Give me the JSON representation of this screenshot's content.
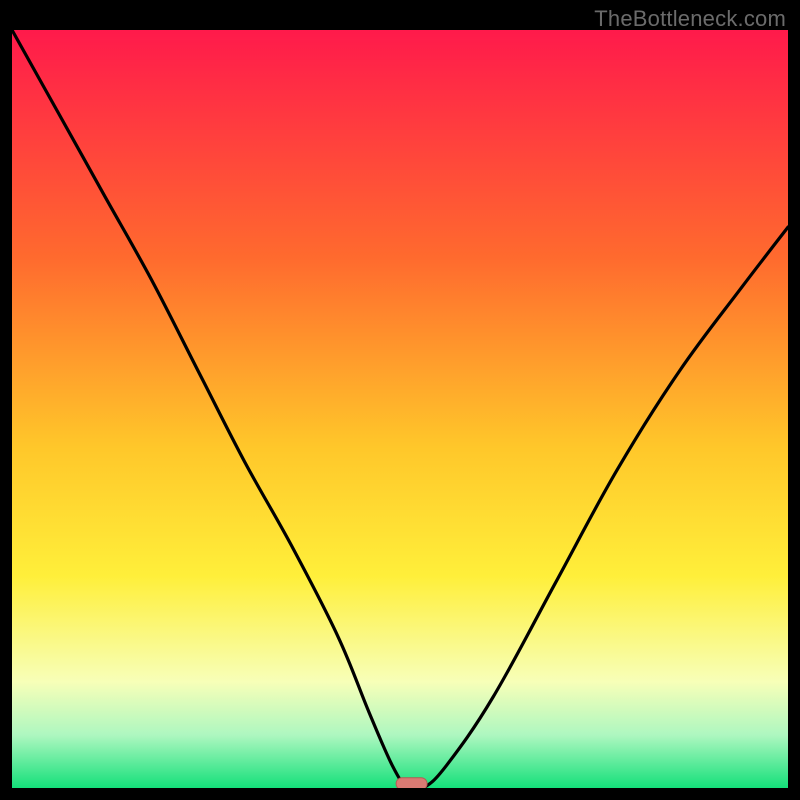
{
  "watermark": "TheBottleneck.com",
  "colors": {
    "black": "#000000",
    "grad_top": "#ff1a4b",
    "grad_mid1": "#ff6a2e",
    "grad_mid2": "#ffc72a",
    "grad_mid3": "#ffef3a",
    "grad_low1": "#f7ffb8",
    "grad_low2": "#aef7c0",
    "grad_bottom": "#14e07a",
    "curve": "#000000",
    "marker_fill": "#d97a73",
    "marker_stroke": "#b55a52"
  },
  "chart_data": {
    "type": "line",
    "title": "",
    "xlabel": "",
    "ylabel": "",
    "xlim": [
      0,
      100
    ],
    "ylim": [
      0,
      100
    ],
    "series": [
      {
        "name": "bottleneck-curve",
        "x": [
          0,
          6,
          12,
          18,
          24,
          30,
          36,
          42,
          46,
          49,
          51,
          53,
          56,
          62,
          70,
          78,
          86,
          94,
          100
        ],
        "y": [
          100,
          89,
          78,
          67,
          55,
          43,
          32,
          20,
          10,
          3,
          0,
          0,
          3,
          12,
          27,
          42,
          55,
          66,
          74
        ]
      }
    ],
    "marker": {
      "x": 51.5,
      "y": 0,
      "width_pct": 4.0,
      "height_pct": 1.6
    },
    "gradient_stops": [
      {
        "offset": 0.0,
        "color_key": "grad_top"
      },
      {
        "offset": 0.3,
        "color_key": "grad_mid1"
      },
      {
        "offset": 0.55,
        "color_key": "grad_mid2"
      },
      {
        "offset": 0.72,
        "color_key": "grad_mid3"
      },
      {
        "offset": 0.86,
        "color_key": "grad_low1"
      },
      {
        "offset": 0.93,
        "color_key": "grad_low2"
      },
      {
        "offset": 1.0,
        "color_key": "grad_bottom"
      }
    ]
  }
}
